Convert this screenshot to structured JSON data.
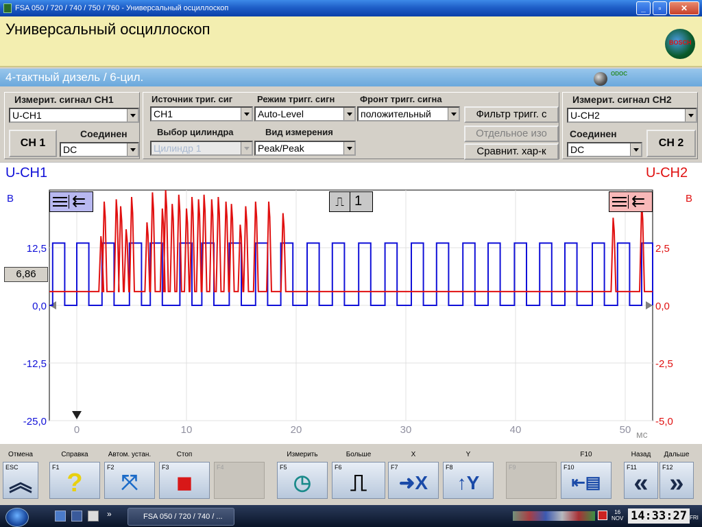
{
  "window": {
    "title": "FSA 050 / 720 / 740 / 750 / 760 - Универсальный осциллоскоп"
  },
  "header": {
    "title": "Универсальный осциллоскоп",
    "logo_text": "BOSCH"
  },
  "subbar": {
    "engine": "4-тактный дизель /  6-цил.",
    "conn_icon_text": "ODOC"
  },
  "controls": {
    "ch1_label": "Измерит. сигнал CH1",
    "ch1_signal": "U-CH1",
    "ch1_button": "CH 1",
    "ch1_coupling_label": "Соединен",
    "ch1_coupling": "DC",
    "trig_source_label": "Источник триг. сиг",
    "trig_source": "CH1",
    "trig_mode_label": "Режим тригг. сигн",
    "trig_mode": "Auto-Level",
    "trig_edge_label": "Фронт тригг. сигна",
    "trig_edge": "положительный",
    "cylinder_label": "Выбор цилиндра",
    "cylinder": "Цилиндр 1",
    "measure_label": "Вид измерения",
    "measure": "Peak/Peak",
    "btn_filter": "Фильтр тригг. с",
    "btn_separate": "Отдельное изо",
    "btn_compare": "Сравнит. хар-к",
    "ch2_label": "Измерит. сигнал CH2",
    "ch2_signal": "U-CH2",
    "ch2_button": "CH 2",
    "ch2_coupling_label": "Соединен",
    "ch2_coupling": "DC"
  },
  "scope": {
    "ch1_name": "U-CH1",
    "ch2_name": "U-CH2",
    "ch1_unit": "В",
    "ch2_unit": "В",
    "cursor_value": "6,86",
    "trigger_channel": "1",
    "x_unit": "мс"
  },
  "chart_data": {
    "type": "line",
    "title": "",
    "xlabel": "мс",
    "x_ticks": [
      "0",
      "10",
      "20",
      "30",
      "40",
      "50"
    ],
    "xlim": [
      -2.5,
      52.5
    ],
    "y_left_ticks": [
      "12,5",
      "0,0",
      "-12,5",
      "-25,0"
    ],
    "y_left_range": [
      -25.0,
      25.0
    ],
    "y_right_ticks": [
      "2,5",
      "0,0",
      "-2,5",
      "-5,0"
    ],
    "y_right_range": [
      -5.0,
      5.0
    ],
    "grid": true,
    "series": [
      {
        "name": "U-CH1",
        "color": "#1010d8",
        "axis": "left",
        "description": "square wave, 0 V low to about 13.5 V high",
        "low": 0.0,
        "high": 13.5,
        "pulse_starts_ms": [
          -2.2,
          0.0,
          2.3,
          4.8,
          6.7,
          9.4,
          11.4,
          13.9,
          16.3,
          18.6,
          21.0,
          23.3,
          25.7,
          28.1,
          30.5,
          32.8,
          35.2,
          37.5,
          39.9,
          42.2,
          44.5,
          47.0,
          49.3,
          51.5
        ],
        "pulse_width_ms": 1.1
      },
      {
        "name": "U-CH2",
        "color": "#e01010",
        "axis": "right",
        "description": "baseline about 0.6 V with fast spikes during injection bursts",
        "baseline": 0.6,
        "spike_times_ms": [
          2.2,
          2.5,
          3.6,
          4.0,
          4.5,
          5.0,
          6.4,
          6.9,
          7.8,
          8.1,
          8.7,
          9.3,
          10.0,
          10.5,
          11.1,
          11.6,
          12.3,
          12.9,
          13.6,
          14.1,
          14.9,
          15.4,
          16.3,
          17.5,
          18.8,
          48.9,
          51.5
        ],
        "spike_peaks_v": [
          3.0,
          4.5,
          4.6,
          4.3,
          3.3,
          4.7,
          3.6,
          4.9,
          4.2,
          5.0,
          4.4,
          4.8,
          4.2,
          4.7,
          4.6,
          4.8,
          4.6,
          4.7,
          4.5,
          4.4,
          3.5,
          4.3,
          4.5,
          4.5,
          4.0,
          3.8,
          4.4
        ]
      }
    ]
  },
  "fkeys": [
    {
      "key": "ESC",
      "caption": "Отмена",
      "icon": "double-up-icon",
      "enabled": true
    },
    {
      "key": "F1",
      "caption": "Справка",
      "icon": "help-icon",
      "enabled": true
    },
    {
      "key": "F2",
      "caption": "Автом. устан.",
      "icon": "autoscale-icon",
      "enabled": true
    },
    {
      "key": "F3",
      "caption": "Стоп",
      "icon": "stop-icon",
      "enabled": true
    },
    {
      "key": "F4",
      "caption": "",
      "icon": "",
      "enabled": false
    },
    {
      "key": "F5",
      "caption": "Измерить",
      "icon": "measure-icon",
      "enabled": true
    },
    {
      "key": "F6",
      "caption": "Больше",
      "icon": "more-icon",
      "enabled": true
    },
    {
      "key": "F7",
      "caption": "X",
      "icon": "x-axis-icon",
      "enabled": true
    },
    {
      "key": "F8",
      "caption": "Y",
      "icon": "y-axis-icon",
      "enabled": true
    },
    {
      "key": "F9",
      "caption": "",
      "icon": "",
      "enabled": false
    },
    {
      "key": "F10",
      "caption": "F10",
      "icon": "layout-icon",
      "enabled": true
    },
    {
      "key": "F11",
      "caption": "Назад",
      "icon": "back-icon",
      "enabled": true
    },
    {
      "key": "F12",
      "caption": "Дальше",
      "icon": "forward-icon",
      "enabled": true
    }
  ],
  "taskbar": {
    "item": "FSA 050 / 720 / 740 / ...",
    "date_day": "16",
    "date_month": "NOV",
    "time": "14:33:27",
    "weekday": "FRI"
  },
  "colors": {
    "header_bg": "#f3eeb0",
    "subbar_bg": "#7ab2e0",
    "ch1": "#1010d8",
    "ch2": "#e01010"
  }
}
